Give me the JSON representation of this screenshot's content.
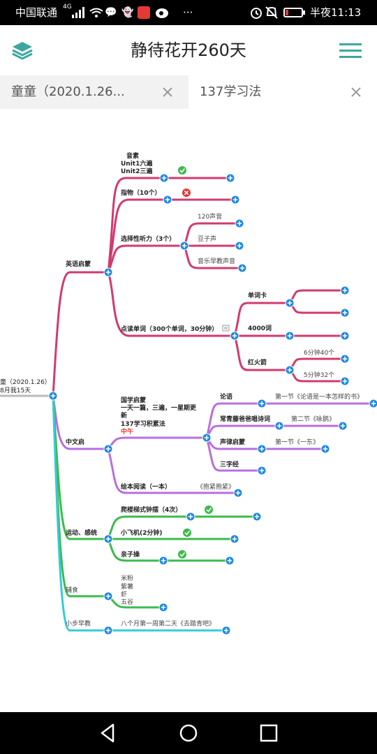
{
  "status_bar": {
    "carrier": "中国联通",
    "network": "4G",
    "time": "半夜11:13"
  },
  "app_bar": {
    "title": "静待花开260天"
  },
  "tabs": [
    {
      "label": "童童（2020.1.26..."
    },
    {
      "label": "137学习法"
    }
  ],
  "mindmap": {
    "root_label_line1": "童（2020.1.26）",
    "root_label_line2": "8月我15天",
    "branches": {
      "english": "英语启蒙",
      "chinese": "中文启",
      "sports": "运动、感统",
      "food": "辅食",
      "early": "小步早教"
    },
    "english": {
      "phonics_line1": "音素",
      "phonics_line2": "Unit1六遍",
      "phonics_line3": "Unit2三遍",
      "finger": "指物（10个）",
      "listening": "选择性听力（3个）",
      "listen_items": [
        "120声音",
        "豆子声",
        "音乐早教声音"
      ],
      "reading": "点读单词（300个单词，30分钟）",
      "word_card": "单词卡",
      "words_4000": "4000词",
      "rocket": "红火箭",
      "rocket_items": [
        "6分钟40个",
        "5分钟32个"
      ]
    },
    "chinese": {
      "guoxue_line1": "国学启蒙",
      "guoxue_line2": "一天一篇，三遍，一星期更",
      "guoxue_line3": "新",
      "guoxue_line4": "137学习积累法",
      "guoxue_line5": "中午",
      "lunyu": "论语",
      "lunyu_note": "第一节《论语是一本怎样的书》",
      "poems": "常青藤爸爸唱诗词",
      "poems_note": "第二节《咏鹅》",
      "shenglv": "声律启蒙",
      "shenglv_note": "第一节《一东》",
      "sanzijing": "三字经",
      "picture_book": "绘本阅读（一本）",
      "picture_book_note": "《抱紧抱紧》"
    },
    "sports": {
      "climb": "爬楼梯式钟摆（4次）",
      "plane": "小飞机(2分钟)",
      "parent": "亲子操"
    },
    "food": {
      "items_line1": "米粉",
      "items_line2": "紫薯",
      "items_line3": "虾",
      "items_line4": "五谷"
    },
    "early": {
      "note": "八个月第一周第二天《去踏青吧》"
    }
  },
  "colors": {
    "english": "#d23a6e",
    "chinese": "#b86ee0",
    "sports": "#3bbb4c",
    "food": "#3bbb4c",
    "early": "#35cbd9",
    "accent": "#1e88e5",
    "teal": "#3aa8a0"
  }
}
